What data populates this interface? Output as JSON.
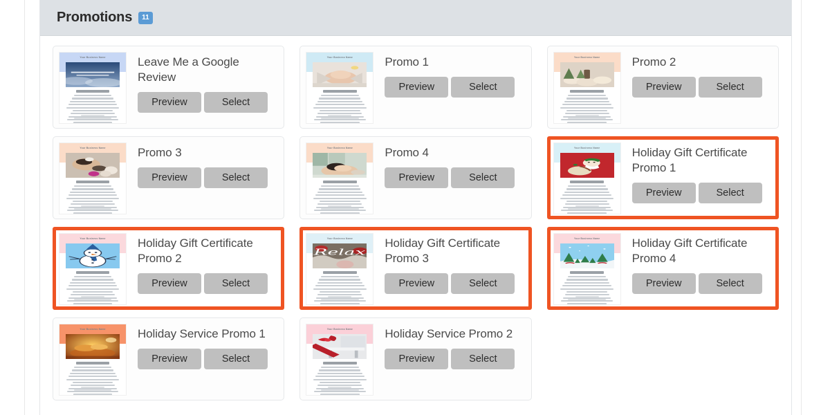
{
  "header": {
    "title": "Promotions",
    "badge_count": "11"
  },
  "buttons": {
    "preview_label": "Preview",
    "select_label": "Select"
  },
  "thumbnail": {
    "business_name": "Your Business Name"
  },
  "colors": {
    "selected_border": "#ef5423",
    "badge": "#5b9bd5",
    "header_bg": "#dde1e5",
    "button_bg": "#bfbfbf"
  },
  "cards": [
    {
      "title": "Leave Me a Google Review",
      "selected": false,
      "band": "#c7d7f5",
      "hero": "clouds",
      "preview_label": "Preview",
      "select_label": "Select"
    },
    {
      "title": "Promo 1",
      "selected": false,
      "band": "#cfeaf5",
      "hero": "massage",
      "preview_label": "Preview",
      "select_label": "Select"
    },
    {
      "title": "Promo 2",
      "selected": false,
      "band": "#fbdcc8",
      "hero": "candles",
      "preview_label": "Preview",
      "select_label": "Select"
    },
    {
      "title": "Promo 3",
      "selected": false,
      "band": "#fbdcc8",
      "hero": "spa-stones",
      "preview_label": "Preview",
      "select_label": "Select"
    },
    {
      "title": "Promo 4",
      "selected": false,
      "band": "#fbdcc8",
      "hero": "spa-relax",
      "preview_label": "Preview",
      "select_label": "Select"
    },
    {
      "title": "Holiday Gift Certificate Promo 1",
      "selected": true,
      "band": "#d8f0f7",
      "hero": "santa",
      "preview_label": "Preview",
      "select_label": "Select"
    },
    {
      "title": "Holiday Gift Certificate Promo 2",
      "selected": true,
      "band": "#fbd9dd",
      "hero": "snowman",
      "preview_label": "Preview",
      "select_label": "Select"
    },
    {
      "title": "Holiday Gift Certificate Promo 3",
      "selected": true,
      "band": "#dff0f7",
      "hero": "relax",
      "preview_label": "Preview",
      "select_label": "Select"
    },
    {
      "title": "Holiday Gift Certificate Promo 4",
      "selected": true,
      "band": "#fbd9dd",
      "hero": "winter-trees",
      "preview_label": "Preview",
      "select_label": "Select"
    },
    {
      "title": "Holiday Service Promo 1",
      "selected": false,
      "band": "#f7936a",
      "hero": "warm-massage",
      "preview_label": "Preview",
      "select_label": "Select"
    },
    {
      "title": "Holiday Service Promo 2",
      "selected": false,
      "band": "#fbd0d8",
      "hero": "gift-ribbon",
      "preview_label": "Preview",
      "select_label": "Select"
    }
  ]
}
